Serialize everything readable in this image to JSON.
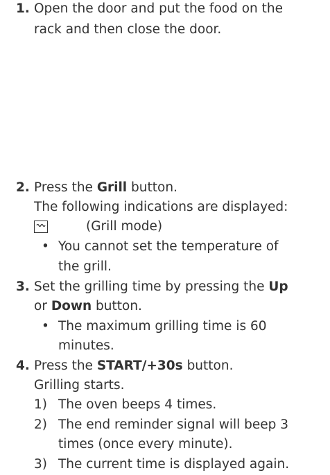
{
  "steps": [
    {
      "num": "1.",
      "lines": [
        "Open the door and put the food on the",
        "rack and then close the door."
      ]
    },
    {
      "num": "2.",
      "press_prefix": "Press the ",
      "press_bold": "Grill",
      "press_suffix": " button.",
      "indications": "The following indications are displayed:",
      "mode_icon": "grill-mode-icon",
      "mode_label": "(Grill mode)",
      "bullet_lines": [
        "You cannot set the temperature of",
        "the grill."
      ]
    },
    {
      "num": "3.",
      "prefix": "Set the grilling time by pressing the ",
      "up": "Up",
      "or_text": "or ",
      "down": "Down",
      "button_suffix": " button.",
      "bullet_lines": [
        "The maximum grilling time is 60",
        "minutes."
      ]
    },
    {
      "num": "4.",
      "press_prefix": "Press the ",
      "press_bold": "START/+30s",
      "press_suffix": " button.",
      "starts": "Grilling starts.",
      "substeps": [
        {
          "marker": "1)",
          "lines": [
            "The oven beeps 4 times."
          ]
        },
        {
          "marker": "2)",
          "lines": [
            "The end reminder signal will beep 3",
            "times (once every minute)."
          ]
        },
        {
          "marker": "3)",
          "lines": [
            "The current time is displayed again."
          ]
        }
      ]
    }
  ],
  "bullet_char": "•"
}
